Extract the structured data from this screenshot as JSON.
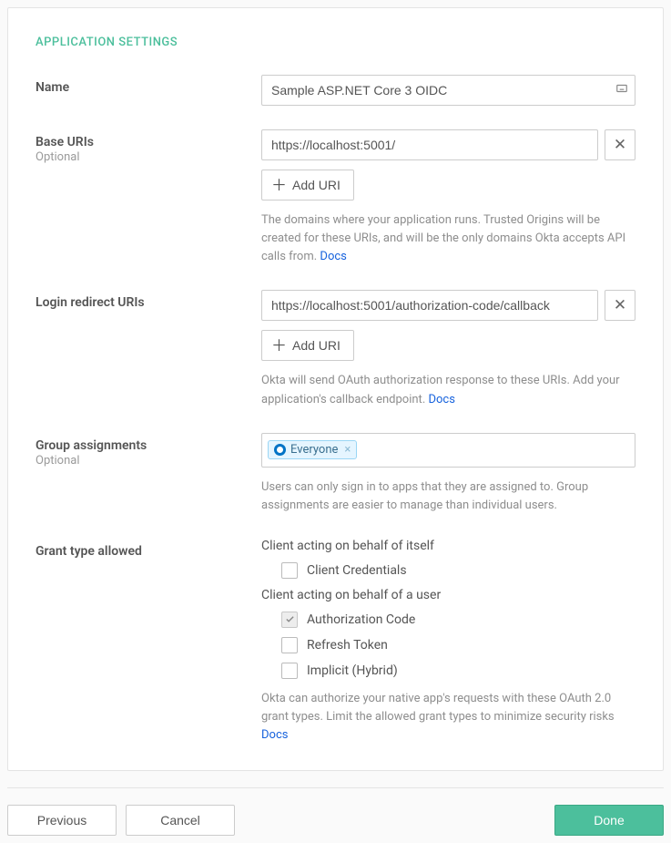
{
  "section_title": "APPLICATION SETTINGS",
  "name": {
    "label": "Name",
    "value": "Sample ASP.NET Core 3 OIDC"
  },
  "base_uris": {
    "label": "Base URIs",
    "sub": "Optional",
    "value": "https://localhost:5001/",
    "add_label": "Add URI",
    "help_a": "The domains where your application runs. Trusted Origins will be created for these URIs, and will be the only domains Okta accepts API calls from. ",
    "docs": "Docs"
  },
  "login_redirect": {
    "label": "Login redirect URIs",
    "value": "https://localhost:5001/authorization-code/callback",
    "add_label": "Add URI",
    "help": "Okta will send OAuth authorization response to these URIs. Add your application's callback endpoint. ",
    "docs": "Docs"
  },
  "groups": {
    "label": "Group assignments",
    "sub": "Optional",
    "tag": "Everyone",
    "help": "Users can only sign in to apps that they are assigned to. Group assignments are easier to manage than individual users."
  },
  "grant": {
    "label": "Grant type allowed",
    "itself_header": "Client acting on behalf of itself",
    "client_credentials": "Client Credentials",
    "user_header": "Client acting on behalf of a user",
    "authorization_code": "Authorization Code",
    "refresh_token": "Refresh Token",
    "implicit": "Implicit (Hybrid)",
    "help": "Okta can authorize your native app's requests with these OAuth 2.0 grant types. Limit the allowed grant types to minimize security risks ",
    "docs": "Docs"
  },
  "footer": {
    "previous": "Previous",
    "cancel": "Cancel",
    "done": "Done"
  }
}
